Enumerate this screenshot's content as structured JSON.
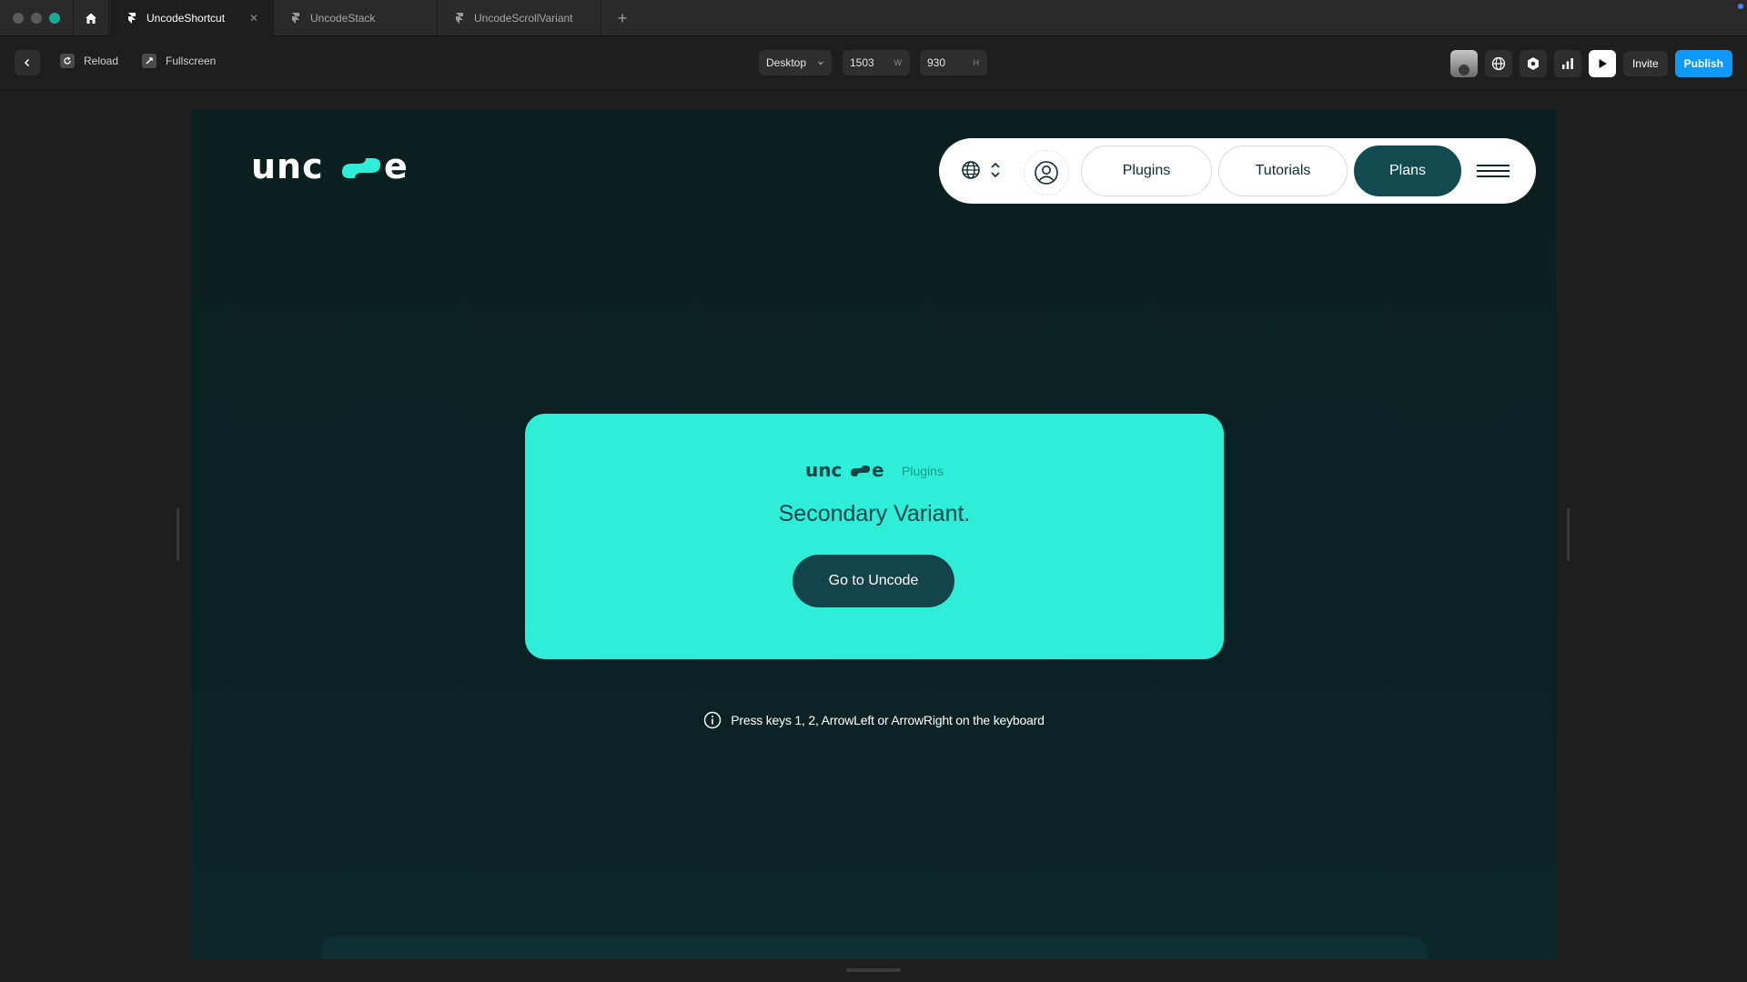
{
  "tabs": [
    {
      "label": "UncodeShortcut",
      "active": true
    },
    {
      "label": "UncodeStack",
      "active": false
    },
    {
      "label": "UncodeScrollVariant",
      "active": false
    }
  ],
  "toolbar": {
    "reload_label": "Reload",
    "fullscreen_label": "Fullscreen",
    "device": "Desktop",
    "width_value": "1503",
    "width_suffix": "W",
    "height_value": "930",
    "height_suffix": "H",
    "invite_label": "Invite",
    "publish_label": "Publish"
  },
  "site": {
    "logo_text": "uncode",
    "nav": {
      "plugins_label": "Plugins",
      "tutorials_label": "Tutorials",
      "plans_label": "Plans"
    },
    "card": {
      "logo_text": "uncode",
      "logo_tag": "Plugins",
      "title": "Secondary Variant.",
      "button_label": "Go to Uncode"
    },
    "hint": "Press keys 1, 2, ArrowLeft or ArrowRight on the keyboard"
  },
  "colors": {
    "accent": "#2eeed8",
    "dark_teal": "#124449",
    "site_bg": "#0b1f20",
    "publish_blue": "#0d99ff"
  },
  "icons": [
    "home-icon",
    "framer-icon",
    "close-icon",
    "plus-icon",
    "chevron-left-icon",
    "reload-icon",
    "fullscreen-icon",
    "chevron-down-icon",
    "globe-icon",
    "settings-icon",
    "analytics-icon",
    "play-icon",
    "user-icon",
    "updown-chevron-icon",
    "hamburger-icon",
    "info-icon"
  ]
}
